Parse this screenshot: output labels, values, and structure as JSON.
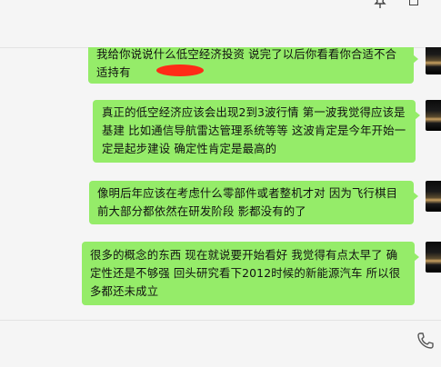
{
  "messages": [
    {
      "text": "我给你说说什么低空经济投资  说完了以后你看看你合适不合适持有"
    },
    {
      "text": "真正的低空经济应该会出现2到3波行情   第一波我觉得应该是基建 比如通信导航雷达管理系统等等   这波肯定是今年开始一定是起步建设  确定性肯定是最高的"
    },
    {
      "text": "像明后年应该在考虑什么零部件或者整机才对  因为飞行棋目前大部分都依然在研发阶段 影都没有的了"
    },
    {
      "text": "很多的概念的东西 现在就说要开始看好 我觉得有点太早了  确定性还是不够强   回头研究看下2012时候的新能源汽车 所以很多都还未成立"
    }
  ],
  "icons": {
    "pin": "pin-icon",
    "maximize": "maximize-icon",
    "phone": "phone-icon",
    "avatar": "avatar"
  },
  "colors": {
    "bubble": "#95ec69",
    "background": "#f5f5f5",
    "redaction": "#e8220f"
  }
}
